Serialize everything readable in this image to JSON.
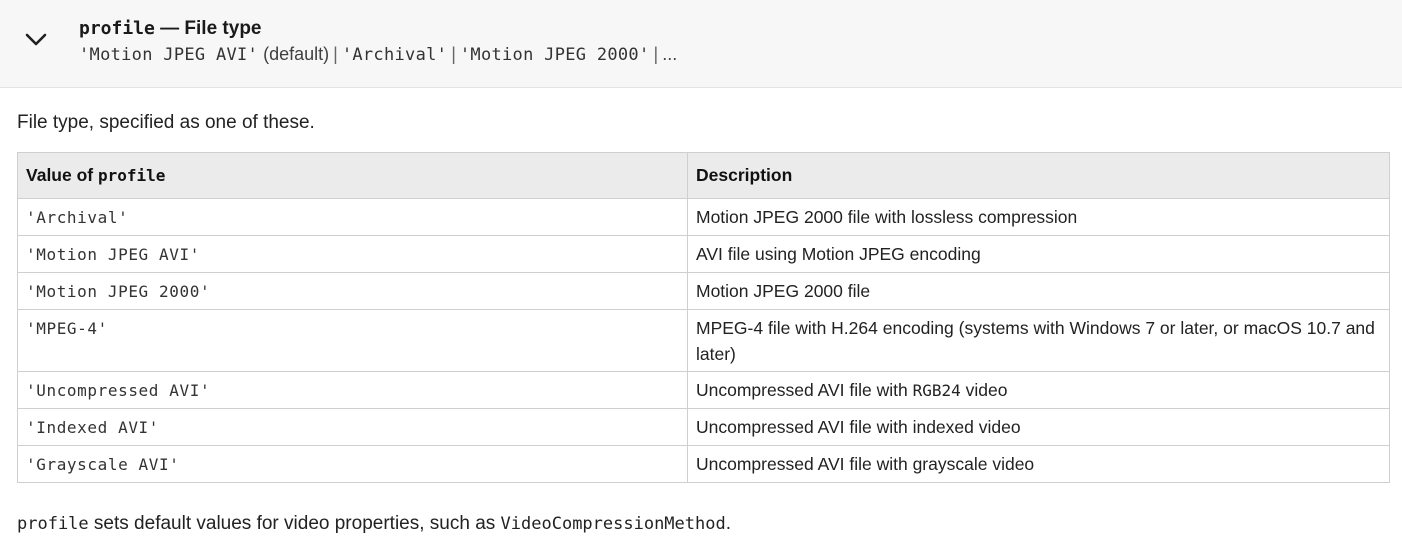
{
  "header": {
    "title_code": "profile",
    "title_text": " — File type",
    "sub": {
      "default_value": "'Motion JPEG AVI'",
      "default_label": " (default)",
      "separator": "|",
      "value2": "'Archival'",
      "value3": "'Motion JPEG 2000'",
      "ellipsis": "..."
    }
  },
  "intro": "File type, specified as one of these.",
  "table": {
    "col1_header_text": "Value of ",
    "col1_header_code": "profile",
    "col2_header": "Description",
    "rows": [
      {
        "value": "'Archival'",
        "desc": "Motion JPEG 2000 file with lossless compression"
      },
      {
        "value": "'Motion JPEG AVI'",
        "desc": "AVI file using Motion JPEG encoding"
      },
      {
        "value": "'Motion JPEG 2000'",
        "desc": "Motion JPEG 2000 file"
      },
      {
        "value": "'MPEG-4'",
        "desc": "MPEG-4 file with H.264 encoding (systems with Windows 7 or later, or macOS 10.7 and later)"
      },
      {
        "value": "'Uncompressed AVI'",
        "desc_pre": "Uncompressed AVI file with ",
        "desc_code": "RGB24",
        "desc_post": " video"
      },
      {
        "value": "'Indexed AVI'",
        "desc": "Uncompressed AVI file with indexed video"
      },
      {
        "value": "'Grayscale AVI'",
        "desc": "Uncompressed AVI file with grayscale video"
      }
    ]
  },
  "footnote": {
    "code1": "profile",
    "text1": " sets default values for video properties, such as ",
    "code2": "VideoCompressionMethod",
    "text2": "."
  },
  "icons": {
    "toggle": "chevron-down-icon"
  }
}
